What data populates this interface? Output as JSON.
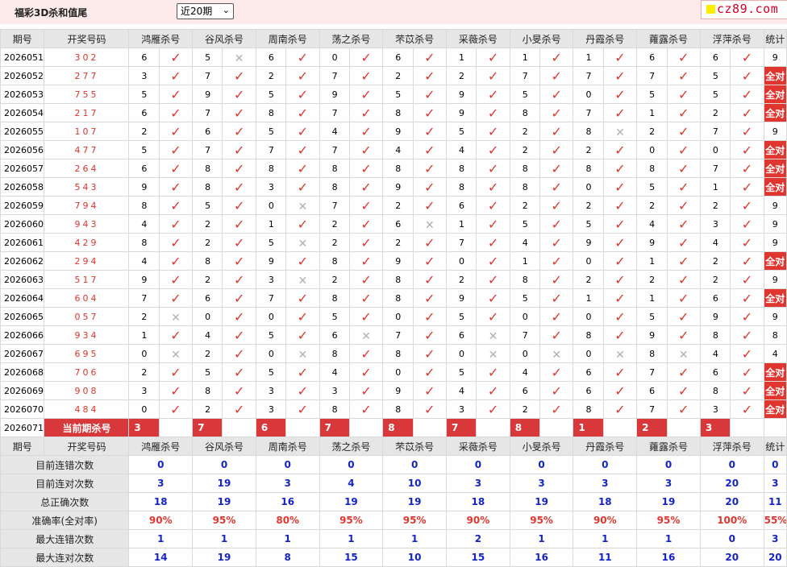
{
  "title": "福彩3D杀和值尾",
  "period_select": {
    "value": "近20期"
  },
  "logo": {
    "text": "cz89.com"
  },
  "header": {
    "issue": "期号",
    "numbers": "开奖号码",
    "experts": [
      "鸿雁杀号",
      "谷风杀号",
      "周南杀号",
      "荡之杀号",
      "芣苡杀号",
      "采薇杀号",
      "小旻杀号",
      "丹霞杀号",
      "蕹露杀号",
      "浮萍杀号"
    ],
    "stat": "统计"
  },
  "rows": [
    {
      "issue": "2026051",
      "nums": "302",
      "kill": [
        "6",
        "5",
        "6",
        "0",
        "6",
        "1",
        "1",
        "1",
        "6",
        "6"
      ],
      "ok": [
        1,
        0,
        1,
        1,
        1,
        1,
        1,
        1,
        1,
        1
      ],
      "stat": "9"
    },
    {
      "issue": "2026052",
      "nums": "277",
      "kill": [
        "3",
        "7",
        "2",
        "7",
        "2",
        "2",
        "7",
        "7",
        "7",
        "5"
      ],
      "ok": [
        1,
        1,
        1,
        1,
        1,
        1,
        1,
        1,
        1,
        1
      ],
      "stat": "全对"
    },
    {
      "issue": "2026053",
      "nums": "755",
      "kill": [
        "5",
        "9",
        "5",
        "9",
        "5",
        "9",
        "5",
        "0",
        "5",
        "5"
      ],
      "ok": [
        1,
        1,
        1,
        1,
        1,
        1,
        1,
        1,
        1,
        1
      ],
      "stat": "全对"
    },
    {
      "issue": "2026054",
      "nums": "217",
      "kill": [
        "6",
        "7",
        "8",
        "7",
        "8",
        "9",
        "8",
        "7",
        "1",
        "2"
      ],
      "ok": [
        1,
        1,
        1,
        1,
        1,
        1,
        1,
        1,
        1,
        1
      ],
      "stat": "全对"
    },
    {
      "issue": "2026055",
      "nums": "107",
      "kill": [
        "2",
        "6",
        "5",
        "4",
        "9",
        "5",
        "2",
        "8",
        "2",
        "7"
      ],
      "ok": [
        1,
        1,
        1,
        1,
        1,
        1,
        1,
        0,
        1,
        1
      ],
      "stat": "9"
    },
    {
      "issue": "2026056",
      "nums": "477",
      "kill": [
        "5",
        "7",
        "7",
        "7",
        "4",
        "4",
        "2",
        "2",
        "0",
        "0"
      ],
      "ok": [
        1,
        1,
        1,
        1,
        1,
        1,
        1,
        1,
        1,
        1
      ],
      "stat": "全对"
    },
    {
      "issue": "2026057",
      "nums": "264",
      "kill": [
        "6",
        "8",
        "8",
        "8",
        "8",
        "8",
        "8",
        "8",
        "8",
        "7"
      ],
      "ok": [
        1,
        1,
        1,
        1,
        1,
        1,
        1,
        1,
        1,
        1
      ],
      "stat": "全对"
    },
    {
      "issue": "2026058",
      "nums": "543",
      "kill": [
        "9",
        "8",
        "3",
        "8",
        "9",
        "8",
        "8",
        "0",
        "5",
        "1"
      ],
      "ok": [
        1,
        1,
        1,
        1,
        1,
        1,
        1,
        1,
        1,
        1
      ],
      "stat": "全对"
    },
    {
      "issue": "2026059",
      "nums": "794",
      "kill": [
        "8",
        "5",
        "0",
        "7",
        "2",
        "6",
        "2",
        "2",
        "2",
        "2"
      ],
      "ok": [
        1,
        1,
        0,
        1,
        1,
        1,
        1,
        1,
        1,
        1
      ],
      "stat": "9"
    },
    {
      "issue": "2026060",
      "nums": "943",
      "kill": [
        "4",
        "2",
        "1",
        "2",
        "6",
        "1",
        "5",
        "5",
        "4",
        "3"
      ],
      "ok": [
        1,
        1,
        1,
        1,
        0,
        1,
        1,
        1,
        1,
        1
      ],
      "stat": "9"
    },
    {
      "issue": "2026061",
      "nums": "429",
      "kill": [
        "8",
        "2",
        "5",
        "2",
        "2",
        "7",
        "4",
        "9",
        "9",
        "4"
      ],
      "ok": [
        1,
        1,
        0,
        1,
        1,
        1,
        1,
        1,
        1,
        1
      ],
      "stat": "9"
    },
    {
      "issue": "2026062",
      "nums": "294",
      "kill": [
        "4",
        "8",
        "9",
        "8",
        "9",
        "0",
        "1",
        "0",
        "1",
        "2"
      ],
      "ok": [
        1,
        1,
        1,
        1,
        1,
        1,
        1,
        1,
        1,
        1
      ],
      "stat": "全对"
    },
    {
      "issue": "2026063",
      "nums": "517",
      "kill": [
        "9",
        "2",
        "3",
        "2",
        "8",
        "2",
        "8",
        "2",
        "2",
        "2"
      ],
      "ok": [
        1,
        1,
        0,
        1,
        1,
        1,
        1,
        1,
        1,
        1
      ],
      "stat": "9"
    },
    {
      "issue": "2026064",
      "nums": "604",
      "kill": [
        "7",
        "6",
        "7",
        "8",
        "8",
        "9",
        "5",
        "1",
        "1",
        "6"
      ],
      "ok": [
        1,
        1,
        1,
        1,
        1,
        1,
        1,
        1,
        1,
        1
      ],
      "stat": "全对"
    },
    {
      "issue": "2026065",
      "nums": "057",
      "kill": [
        "2",
        "0",
        "0",
        "5",
        "0",
        "5",
        "0",
        "0",
        "5",
        "9"
      ],
      "ok": [
        0,
        1,
        1,
        1,
        1,
        1,
        1,
        1,
        1,
        1
      ],
      "stat": "9"
    },
    {
      "issue": "2026066",
      "nums": "934",
      "kill": [
        "1",
        "4",
        "5",
        "6",
        "7",
        "6",
        "7",
        "8",
        "9",
        "8"
      ],
      "ok": [
        1,
        1,
        1,
        0,
        1,
        0,
        1,
        1,
        1,
        1
      ],
      "stat": "8"
    },
    {
      "issue": "2026067",
      "nums": "695",
      "kill": [
        "0",
        "2",
        "0",
        "8",
        "8",
        "0",
        "0",
        "0",
        "8",
        "4"
      ],
      "ok": [
        0,
        1,
        0,
        1,
        1,
        0,
        0,
        0,
        0,
        1
      ],
      "stat": "4"
    },
    {
      "issue": "2026068",
      "nums": "706",
      "kill": [
        "2",
        "5",
        "5",
        "4",
        "0",
        "5",
        "4",
        "6",
        "7",
        "6"
      ],
      "ok": [
        1,
        1,
        1,
        1,
        1,
        1,
        1,
        1,
        1,
        1
      ],
      "stat": "全对"
    },
    {
      "issue": "2026069",
      "nums": "908",
      "kill": [
        "3",
        "8",
        "3",
        "3",
        "9",
        "4",
        "6",
        "6",
        "6",
        "8"
      ],
      "ok": [
        1,
        1,
        1,
        1,
        1,
        1,
        1,
        1,
        1,
        1
      ],
      "stat": "全对"
    },
    {
      "issue": "2026070",
      "nums": "484",
      "kill": [
        "0",
        "2",
        "3",
        "8",
        "8",
        "3",
        "2",
        "8",
        "7",
        "3"
      ],
      "ok": [
        1,
        1,
        1,
        1,
        1,
        1,
        1,
        1,
        1,
        1
      ],
      "stat": "全对"
    }
  ],
  "current": {
    "issue": "2026071",
    "label": "当前期杀号",
    "kill": [
      "3",
      "7",
      "6",
      "7",
      "8",
      "7",
      "8",
      "1",
      "2",
      "3"
    ]
  },
  "summary": [
    {
      "label": "目前连错次数",
      "values": [
        "0",
        "0",
        "0",
        "0",
        "0",
        "0",
        "0",
        "0",
        "0",
        "0"
      ],
      "stat": "0"
    },
    {
      "label": "目前连对次数",
      "values": [
        "3",
        "19",
        "3",
        "4",
        "10",
        "3",
        "3",
        "3",
        "3",
        "20"
      ],
      "stat": "3"
    },
    {
      "label": "总正确次数",
      "values": [
        "18",
        "19",
        "16",
        "19",
        "19",
        "18",
        "19",
        "18",
        "19",
        "20"
      ],
      "stat": "11"
    },
    {
      "label": "准确率(全对率)",
      "values": [
        "90%",
        "95%",
        "80%",
        "95%",
        "95%",
        "90%",
        "95%",
        "90%",
        "95%",
        "100%"
      ],
      "stat": "55%"
    },
    {
      "label": "最大连错次数",
      "values": [
        "1",
        "1",
        "1",
        "1",
        "1",
        "2",
        "1",
        "1",
        "1",
        "0"
      ],
      "stat": "3"
    },
    {
      "label": "最大连对次数",
      "values": [
        "14",
        "19",
        "8",
        "15",
        "10",
        "15",
        "16",
        "11",
        "16",
        "20"
      ],
      "stat": "20"
    }
  ]
}
